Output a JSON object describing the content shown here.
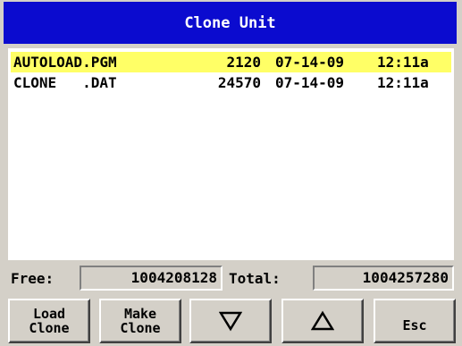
{
  "window": {
    "title": "Clone Unit"
  },
  "files": [
    {
      "name": "AUTOLOAD.PGM",
      "size": "2120",
      "date": "07-14-09",
      "time": "12:11a",
      "selected": true
    },
    {
      "name": "CLONE   .DAT",
      "size": "24570",
      "date": "07-14-09",
      "time": "12:11a",
      "selected": false
    }
  ],
  "status": {
    "free_label": "Free:",
    "free_value": "1004208128",
    "total_label": "Total:",
    "total_value": "1004257280"
  },
  "buttons": {
    "load_clone": {
      "line1": "Load",
      "line2": "Clone"
    },
    "make_clone": {
      "line1": "Make",
      "line2": "Clone"
    },
    "down_icon": "triangle-down-icon",
    "up_icon": "triangle-up-icon",
    "esc": "Esc"
  },
  "colors": {
    "title_bar": "#0b0bcf",
    "selection": "#ffff66",
    "panel": "#d4d0c8"
  }
}
